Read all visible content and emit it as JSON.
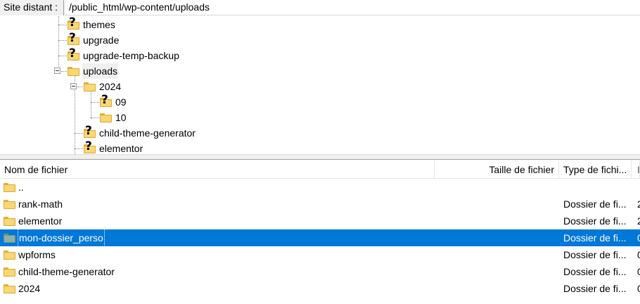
{
  "pathbar": {
    "label": "Site distant :",
    "path": "/public_html/wp-content/uploads"
  },
  "tree": {
    "nodes": [
      {
        "label": "themes",
        "icon": "unknown-folder-icon"
      },
      {
        "label": "upgrade",
        "icon": "unknown-folder-icon"
      },
      {
        "label": "upgrade-temp-backup",
        "icon": "unknown-folder-icon"
      },
      {
        "label": "uploads",
        "icon": "folder-icon"
      },
      {
        "label": "2024",
        "icon": "folder-icon"
      },
      {
        "label": "09",
        "icon": "unknown-folder-icon"
      },
      {
        "label": "10",
        "icon": "folder-icon"
      },
      {
        "label": "child-theme-generator",
        "icon": "unknown-folder-icon"
      },
      {
        "label": "elementor",
        "icon": "unknown-folder-icon"
      }
    ]
  },
  "list": {
    "headers": {
      "name": "Nom de fichier",
      "size": "Taille de fichier",
      "type": "Type de fichi...",
      "extra": "I"
    },
    "rows": [
      {
        "name": "..",
        "type": "",
        "extra": "",
        "selected": false
      },
      {
        "name": "rank-math",
        "type": "Dossier de fi...",
        "extra": "2",
        "selected": false
      },
      {
        "name": "elementor",
        "type": "Dossier de fi...",
        "extra": "2",
        "selected": false
      },
      {
        "name": "mon-dossier_perso",
        "type": "Dossier de fi...",
        "extra": "0",
        "selected": true
      },
      {
        "name": "wpforms",
        "type": "Dossier de fi...",
        "extra": "0",
        "selected": false
      },
      {
        "name": "child-theme-generator",
        "type": "Dossier de fi...",
        "extra": "0",
        "selected": false
      },
      {
        "name": "2024",
        "type": "Dossier de fi...",
        "extra": "0",
        "selected": false
      }
    ]
  },
  "colors": {
    "selection": "#0078d7",
    "folder": "#f8d775",
    "selected_folder": "#8fb0a8"
  }
}
